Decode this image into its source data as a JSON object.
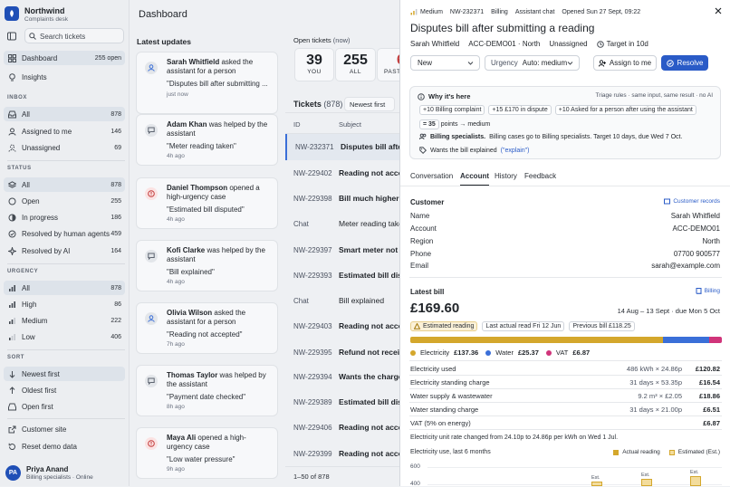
{
  "brand": {
    "name": "Northwind",
    "subtitle": "Complaints desk"
  },
  "search": {
    "placeholder": "Search tickets"
  },
  "sidebar": {
    "nav": [
      {
        "label": "Dashboard",
        "count": "255 open",
        "icon": "grid-icon"
      },
      {
        "label": "Insights",
        "count": "",
        "icon": "lightbulb-icon"
      }
    ],
    "inbox_heading": "INBOX",
    "inbox": [
      {
        "label": "All",
        "count": "878"
      },
      {
        "label": "Assigned to me",
        "count": "146"
      },
      {
        "label": "Unassigned",
        "count": "69"
      }
    ],
    "status_heading": "STATUS",
    "status": [
      {
        "label": "All",
        "count": "878"
      },
      {
        "label": "Open",
        "count": "255"
      },
      {
        "label": "In progress",
        "count": "186"
      },
      {
        "label": "Resolved by human agents",
        "count": "459"
      },
      {
        "label": "Resolved by AI",
        "count": "164"
      }
    ],
    "urgency_heading": "URGENCY",
    "urgency": [
      {
        "label": "All",
        "count": "878"
      },
      {
        "label": "High",
        "count": "86"
      },
      {
        "label": "Medium",
        "count": "222"
      },
      {
        "label": "Low",
        "count": "406"
      }
    ],
    "sort_heading": "SORT",
    "sort": [
      {
        "label": "Newest first"
      },
      {
        "label": "Oldest first"
      },
      {
        "label": "Open first"
      }
    ],
    "footer": [
      {
        "label": "Customer site"
      },
      {
        "label": "Reset demo data"
      }
    ],
    "user": {
      "initials": "PA",
      "name": "Priya Anand",
      "role": "Billing specialists · Online"
    }
  },
  "header": {
    "title": "Dashboard"
  },
  "updates": {
    "title": "Latest updates",
    "cards": [
      {
        "name": "Sarah Whitfield",
        "action": "asked the assistant for a person",
        "quote": "\"Disputes bill after submitting ...",
        "time": "just now"
      },
      {
        "name": "Adam Khan",
        "action": "was helped by the assistant",
        "quote": "\"Meter reading taken\"",
        "time": "4h ago"
      },
      {
        "name": "Daniel Thompson",
        "action": "opened a high-urgency case",
        "quote": "\"Estimated bill disputed\"",
        "time": "4h ago"
      },
      {
        "name": "Kofi Clarke",
        "action": "was helped by the assistant",
        "quote": "\"Bill explained\"",
        "time": "4h ago"
      },
      {
        "name": "Olivia Wilson",
        "action": "asked the assistant for a person",
        "quote": "\"Reading not accepted\"",
        "time": "7h ago"
      },
      {
        "name": "Thomas Taylor",
        "action": "was helped by the assistant",
        "quote": "\"Payment date checked\"",
        "time": "8h ago"
      },
      {
        "name": "Maya Ali",
        "action": "opened a high-urgency case",
        "quote": "\"Low water pressure\"",
        "time": "9h ago"
      }
    ]
  },
  "open_tickets": {
    "label": "Open tickets",
    "sub": "(now)",
    "stats": [
      {
        "value": "39",
        "label": "YOU"
      },
      {
        "value": "255",
        "label": "ALL"
      },
      {
        "value": "6",
        "label": "PAST"
      }
    ]
  },
  "tickets": {
    "title": "Tickets",
    "count": "(878)",
    "sort": "Newest first",
    "columns": [
      "ID",
      "Subject"
    ],
    "rows": [
      {
        "id": "NW-232371",
        "subject": "Disputes bill after submitting a reading",
        "bold": true
      },
      {
        "id": "NW-229402",
        "subject": "Reading not accepted",
        "bold": true
      },
      {
        "id": "NW-229398",
        "subject": "Bill much higher than usual",
        "bold": true
      },
      {
        "id": "Chat",
        "subject": "Meter reading taken",
        "bold": false
      },
      {
        "id": "NW-229397",
        "subject": "Smart meter not sending readings",
        "bold": true
      },
      {
        "id": "NW-229393",
        "subject": "Estimated bill disputed",
        "bold": true
      },
      {
        "id": "Chat",
        "subject": "Bill explained",
        "bold": false
      },
      {
        "id": "NW-229403",
        "subject": "Reading not accepted",
        "bold": true
      },
      {
        "id": "NW-229395",
        "subject": "Refund not received",
        "bold": true
      },
      {
        "id": "NW-229394",
        "subject": "Wants the charges explained",
        "bold": true
      },
      {
        "id": "NW-229389",
        "subject": "Estimated bill disputed",
        "bold": true
      },
      {
        "id": "NW-229406",
        "subject": "Reading not accepted",
        "bold": true
      },
      {
        "id": "NW-229399",
        "subject": "Reading not accepted",
        "bold": true
      }
    ],
    "pager": "1–50 of 878"
  },
  "detail": {
    "urgency_tag": "Medium",
    "ticket_id": "NW-232371",
    "category": "Billing",
    "channel": "Assistant chat",
    "opened": "Opened Sun 27 Sept, 09:22",
    "title": "Disputes bill after submitting a reading",
    "customer": "Sarah Whitfield",
    "account_region": "ACC-DEMO01 · North",
    "assignee": "Unassigned",
    "target": "Target in 10d",
    "status_value": "New",
    "urgency_label": "Urgency",
    "urgency_value": "Auto: medium",
    "assign_label": "Assign to me",
    "resolve_label": "Resolve",
    "why": {
      "title": "Why it's here",
      "meta": "Triage rules · same input, same result · no AI",
      "chips": [
        {
          "delta": "+10",
          "text": "Billing complaint"
        },
        {
          "delta": "+15",
          "text": "£170 in dispute"
        },
        {
          "delta": "+10",
          "text": "Asked for a person after using the assistant"
        }
      ],
      "points_delta": "= 35",
      "points_text": "points → medium",
      "routing_bold": "Billing specialists.",
      "routing_text": "Billing cases go to Billing specialists. Target 10 days, due Wed 7 Oct.",
      "wants_text": "Wants the bill explained",
      "explain_link": "(\"explain\")"
    },
    "tabs": [
      "Conversation",
      "Account",
      "History",
      "Feedback"
    ],
    "customer_section": {
      "title": "Customer",
      "records_link": "Customer records",
      "fields": [
        {
          "label": "Name",
          "value": "Sarah Whitfield"
        },
        {
          "label": "Account",
          "value": "ACC-DEMO01"
        },
        {
          "label": "Region",
          "value": "North"
        },
        {
          "label": "Phone",
          "value": "07700 900577"
        },
        {
          "label": "Email",
          "value": "sarah@example.com"
        }
      ]
    },
    "bill": {
      "title": "Latest bill",
      "billing_link": "Billing",
      "amount": "£169.60",
      "period": "14 Aug – 13 Sept · due Mon 5 Oct",
      "estimated_tag": "Estimated reading",
      "last_actual": "Last actual read Fri 12 Jun",
      "previous": "Previous bill £118.25",
      "split": [
        {
          "name": "Electricity",
          "value": "£137.36",
          "share": 0.81,
          "color": "#d4a72c"
        },
        {
          "name": "Water",
          "value": "£25.37",
          "share": 0.15,
          "color": "#3a6fd8"
        },
        {
          "name": "VAT",
          "value": "£6.87",
          "share": 0.04,
          "color": "#d0347a"
        }
      ],
      "lines": [
        {
          "label": "Electricity used",
          "calc": "486 kWh × 24.86p",
          "amount": "£120.82"
        },
        {
          "label": "Electricity standing charge",
          "calc": "31 days × 53.35p",
          "amount": "£16.54"
        },
        {
          "label": "Water supply & wastewater",
          "calc": "9.2 m³ × £2.05",
          "amount": "£18.86"
        },
        {
          "label": "Water standing charge",
          "calc": "31 days × 21.00p",
          "amount": "£6.51"
        },
        {
          "label": "VAT (5% on energy)",
          "calc": "",
          "amount": "£6.87"
        }
      ],
      "rate_note": "Electricity unit rate changed from 24.10p to 24.86p per kWh on Wed 1 Jul."
    },
    "usage_chart": {
      "title": "Electricity use, last 6 months",
      "legend_actual": "Actual reading",
      "legend_estimated": "Estimated (Est.)",
      "y_ticks": [
        "600",
        "400"
      ],
      "bar_labels": [
        "Est.",
        "Est.",
        "Est."
      ]
    }
  }
}
